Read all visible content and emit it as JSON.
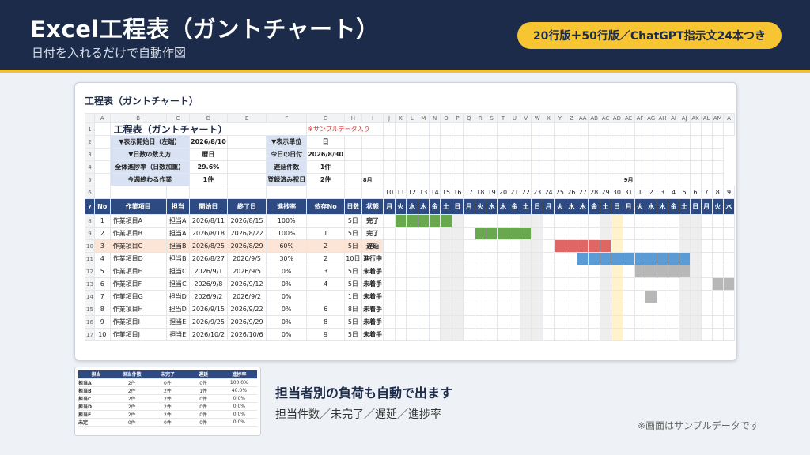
{
  "header": {
    "title": "Excel工程表（ガントチャート）",
    "subtitle": "日付を入れるだけで自動作図",
    "badge": "20行版＋50行版／ChatGPT指示文24本つき"
  },
  "card_title": "工程表（ガントチャート）",
  "sheet": {
    "columns": [
      "A",
      "B",
      "C",
      "D",
      "E",
      "F",
      "G",
      "H",
      "I",
      "J",
      "K",
      "L",
      "M",
      "N",
      "O",
      "P",
      "Q",
      "R",
      "S",
      "T",
      "U",
      "V",
      "W",
      "X",
      "Y",
      "Z",
      "AA",
      "AB",
      "AC",
      "AD",
      "AE",
      "AF",
      "AG",
      "AH",
      "AI",
      "AJ",
      "AK",
      "AL",
      "AM",
      "A"
    ],
    "sheet_title": "工程表（ガントチャート）",
    "sample_note": "※サンプルデータ入り",
    "info": {
      "start_label": "▼表示開始日（左端）",
      "start_value": "2026/8/10",
      "unit_label": "▼表示単位",
      "unit_value": "日",
      "count_label": "▼日数の数え方",
      "count_value": "暦日",
      "today_label": "今日の日付",
      "today_value": "2026/8/30",
      "progress_label": "全体進捗率（日数加重）",
      "progress_value": "29.6%",
      "delay_label": "遅延件数",
      "delay_value": "1件",
      "week_label": "今週終わる作業",
      "week_value": "1件",
      "holiday_label": "登録済み祝日",
      "holiday_value": "2件"
    },
    "months": [
      "8月",
      "9月"
    ],
    "days": [
      "10",
      "11",
      "12",
      "13",
      "14",
      "15",
      "16",
      "17",
      "18",
      "19",
      "20",
      "21",
      "22",
      "23",
      "24",
      "25",
      "26",
      "27",
      "28",
      "29",
      "30",
      "31",
      "1",
      "2",
      "3",
      "4",
      "5",
      "6",
      "7",
      "8",
      "9"
    ],
    "weekdays": [
      "月",
      "火",
      "水",
      "木",
      "金",
      "土",
      "日",
      "月",
      "火",
      "水",
      "木",
      "金",
      "土",
      "日",
      "月",
      "火",
      "水",
      "木",
      "金",
      "土",
      "日",
      "月",
      "火",
      "水",
      "木",
      "金",
      "土",
      "日",
      "月",
      "火",
      "水"
    ],
    "table_headers": [
      "No",
      "作業項目",
      "担当",
      "開始日",
      "終了日",
      "進捗率",
      "依存No",
      "日数",
      "状態"
    ],
    "tasks": [
      {
        "no": "1",
        "name": "作業項目A",
        "owner": "担当A",
        "start": "2026/8/11",
        "end": "2026/8/15",
        "progress": "100%",
        "dep": "",
        "days": "5日",
        "status": "完了",
        "bar_start": 1,
        "bar_len": 5,
        "bar": "done"
      },
      {
        "no": "2",
        "name": "作業項目B",
        "owner": "担当A",
        "start": "2026/8/18",
        "end": "2026/8/22",
        "progress": "100%",
        "dep": "1",
        "days": "5日",
        "status": "完了",
        "bar_start": 8,
        "bar_len": 5,
        "bar": "done"
      },
      {
        "no": "3",
        "name": "作業項目C",
        "owner": "担当B",
        "start": "2026/8/25",
        "end": "2026/8/29",
        "progress": "60%",
        "dep": "2",
        "days": "5日",
        "status": "遅延",
        "bar_start": 15,
        "bar_len": 5,
        "bar": "late"
      },
      {
        "no": "4",
        "name": "作業項目D",
        "owner": "担当B",
        "start": "2026/8/27",
        "end": "2026/9/5",
        "progress": "30%",
        "dep": "2",
        "days": "10日",
        "status": "進行中",
        "bar_start": 17,
        "bar_len": 10,
        "bar": "prog"
      },
      {
        "no": "5",
        "name": "作業項目E",
        "owner": "担当C",
        "start": "2026/9/1",
        "end": "2026/9/5",
        "progress": "0%",
        "dep": "3",
        "days": "5日",
        "status": "未着手",
        "bar_start": 22,
        "bar_len": 5,
        "bar": "todo"
      },
      {
        "no": "6",
        "name": "作業項目F",
        "owner": "担当C",
        "start": "2026/9/8",
        "end": "2026/9/12",
        "progress": "0%",
        "dep": "4",
        "days": "5日",
        "status": "未着手",
        "bar_start": 29,
        "bar_len": 5,
        "bar": "todo"
      },
      {
        "no": "7",
        "name": "作業項目G",
        "owner": "担当D",
        "start": "2026/9/2",
        "end": "2026/9/2",
        "progress": "0%",
        "dep": "",
        "days": "1日",
        "status": "未着手",
        "bar_start": 23,
        "bar_len": 1,
        "bar": "todo"
      },
      {
        "no": "8",
        "name": "作業項目H",
        "owner": "担当D",
        "start": "2026/9/15",
        "end": "2026/9/22",
        "progress": "0%",
        "dep": "6",
        "days": "8日",
        "status": "未着手",
        "bar_start": 0,
        "bar_len": 0,
        "bar": "todo"
      },
      {
        "no": "9",
        "name": "作業項目I",
        "owner": "担当E",
        "start": "2026/9/25",
        "end": "2026/9/29",
        "progress": "0%",
        "dep": "8",
        "days": "5日",
        "status": "未着手",
        "bar_start": 0,
        "bar_len": 0,
        "bar": "todo"
      },
      {
        "no": "10",
        "name": "作業項目J",
        "owner": "担当E",
        "start": "2026/10/2",
        "end": "2026/10/6",
        "progress": "0%",
        "dep": "9",
        "days": "5日",
        "status": "未着手",
        "bar_start": 0,
        "bar_len": 0,
        "bar": "todo"
      }
    ]
  },
  "summary": {
    "headers": [
      "担当",
      "担当件数",
      "未完了",
      "遅延",
      "進捗率"
    ],
    "rows": [
      [
        "担当A",
        "2件",
        "0件",
        "0件",
        "100.0%"
      ],
      [
        "担当B",
        "2件",
        "2件",
        "1件",
        "40.0%"
      ],
      [
        "担当C",
        "2件",
        "2件",
        "0件",
        "0.0%"
      ],
      [
        "担当D",
        "2件",
        "2件",
        "0件",
        "0.0%"
      ],
      [
        "担当E",
        "2件",
        "2件",
        "0件",
        "0.0%"
      ],
      [
        "未定",
        "0件",
        "0件",
        "0件",
        "0.0%"
      ]
    ]
  },
  "feature": {
    "title": "担当者別の負荷も自動で出ます",
    "sub": "担当件数／未完了／遅延／進捗率"
  },
  "note": "※画面はサンプルデータです",
  "colors": {
    "navy": "#1c2b4a",
    "accent": "#f6c531",
    "done": "#6aa84f",
    "late": "#e06666",
    "prog": "#5b9bd5",
    "todo": "#b7b7b7"
  }
}
